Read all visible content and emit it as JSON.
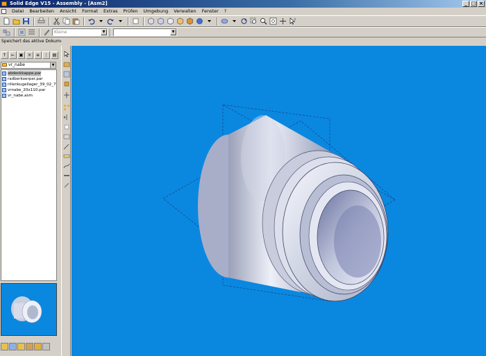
{
  "window": {
    "title": "Solid Edge V15 - Assembly - [Asm2]",
    "buttons": [
      "_",
      "□",
      "×"
    ]
  },
  "menu": [
    "Datei",
    "Bearbeiten",
    "Ansicht",
    "Format",
    "Extras",
    "Prüfen",
    "Umgebung",
    "Verwalten",
    "Fenster",
    "?"
  ],
  "toolbar2": {
    "combo1_value": "Kleine",
    "combo2_value": ""
  },
  "status_text": "Speichert das aktive Dokument",
  "pathfinder": {
    "folder_combo": "vr_nabe",
    "items": [
      {
        "label": "abdeckkappe.par",
        "selected": true
      },
      {
        "label": "radberkoerper.par",
        "selected": false
      },
      {
        "label": "rillenkugellager_39_02_7.p",
        "selected": false
      },
      {
        "label": "vrnabe_20x110.par",
        "selected": false
      },
      {
        "label": "vr_nabe.asm",
        "selected": false
      }
    ]
  },
  "icons": {
    "accent": "#0a88e0",
    "titlebar": "#0a246a"
  }
}
